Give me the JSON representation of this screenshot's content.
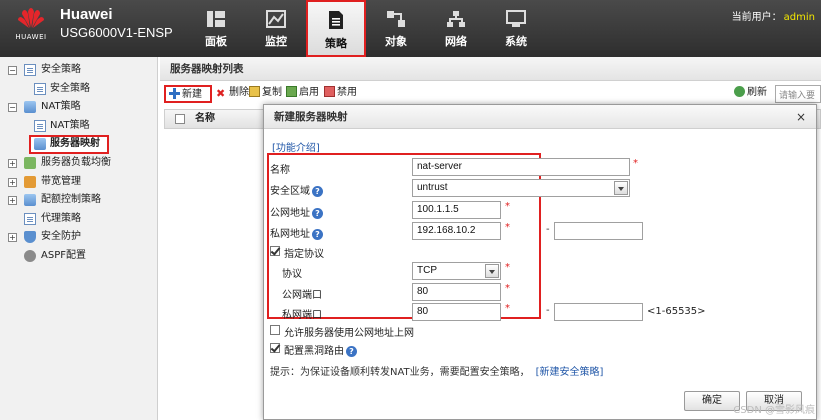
{
  "app": {
    "logo_text": "HUAWEI",
    "brand_line1": "Huawei",
    "brand_line2": "USG6000V1-ENSP",
    "user_label": "当前用户：",
    "user_name": "admin"
  },
  "nav": [
    {
      "label": "面板",
      "icon": "dashboard-icon"
    },
    {
      "label": "监控",
      "icon": "monitor-icon"
    },
    {
      "label": "策略",
      "icon": "policy-document-icon",
      "active": true
    },
    {
      "label": "对象",
      "icon": "object-icon"
    },
    {
      "label": "网络",
      "icon": "network-icon"
    },
    {
      "label": "系统",
      "icon": "system-icon"
    }
  ],
  "sidebar": {
    "items": [
      {
        "label": "安全策略",
        "level": 0,
        "expander": "−"
      },
      {
        "label": "安全策略",
        "level": 1
      },
      {
        "label": "NAT策略",
        "level": 0,
        "expander": "−"
      },
      {
        "label": "NAT策略",
        "level": 1
      },
      {
        "label": "服务器映射",
        "level": 1,
        "selected": true
      },
      {
        "label": "服务器负载均衡",
        "level": 0,
        "expander": "+"
      },
      {
        "label": "带宽管理",
        "level": 0,
        "expander": "+"
      },
      {
        "label": "配额控制策略",
        "level": 0,
        "expander": "+"
      },
      {
        "label": "代理策略",
        "level": 0
      },
      {
        "label": "安全防护",
        "level": 0,
        "expander": "+"
      },
      {
        "label": "ASPF配置",
        "level": 0
      }
    ]
  },
  "main": {
    "panel_title": "服务器映射列表",
    "toolbar": {
      "new": "新建",
      "delete": "删除",
      "copy": "复制",
      "enable": "启用",
      "disable": "禁用",
      "refresh": "刷新",
      "search_placeholder": "请输入要"
    },
    "grid": {
      "col_name": "名称"
    }
  },
  "dialog": {
    "title": "新建服务器映射",
    "close": "×",
    "intro_link": "[功能介绍]",
    "fields": {
      "name_label": "名称",
      "name_value": "nat-server",
      "zone_label": "安全区域",
      "zone_value": "untrust",
      "public_ip_label": "公网地址",
      "public_ip_value": "100.1.1.5",
      "private_ip_label": "私网地址",
      "private_ip_value": "192.168.10.2",
      "private_ip_end_value": "",
      "specify_protocol_label": "指定协议",
      "protocol_label": "协议",
      "protocol_value": "TCP",
      "public_port_label": "公网端口",
      "public_port_value": "80",
      "private_port_label": "私网端口",
      "private_port_value": "80",
      "private_port_end_value": "",
      "port_range": "<1-65535>",
      "allow_internet_label": "允许服务器使用公网地址上网",
      "blackhole_label": "配置黑洞路由"
    },
    "required_mark": "*",
    "dash": "-",
    "hint_text": "提示：为保证设备顺利转发NAT业务，需要配置安全策略，",
    "hint_link": "[新建安全策略]",
    "ok": "确定",
    "cancel": "取消"
  },
  "watermark": "CSDN @雪影风痕",
  "colors": {
    "highlight": "#e02020",
    "link": "#2157a8",
    "header_bg": "#3a3a3a",
    "user_name": "#f2e600"
  }
}
